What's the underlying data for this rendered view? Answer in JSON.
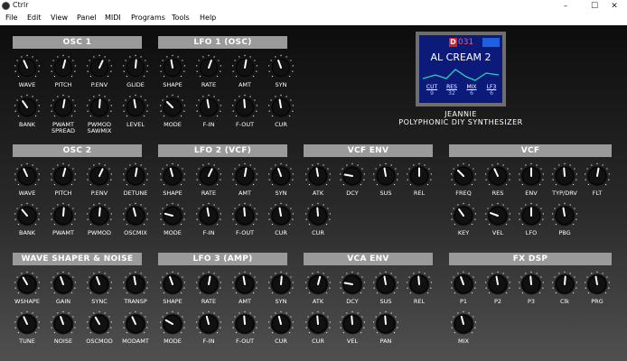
{
  "window": {
    "title": "Ctrlr",
    "controls": {
      "minimize": "–",
      "maximize": "☐",
      "close": "✕"
    }
  },
  "menu": [
    "File",
    "Edit",
    "View",
    "Panel",
    "MIDI",
    "Programs",
    "Tools",
    "Help"
  ],
  "sections": [
    {
      "title": "OSC 1",
      "knobs": [
        "WAVE",
        "PITCH",
        "P.ENV",
        "GLIDE",
        "BANK",
        "PWAMT SPREAD",
        "PWMOD SAWMIX",
        "LEVEL"
      ]
    },
    {
      "title": "LFO 1 (OSC)",
      "knobs": [
        "SHAPE",
        "RATE",
        "AMT",
        "SYN",
        "MODE",
        "F-IN",
        "F-OUT",
        "CUR"
      ]
    },
    {
      "title": "OSC 2",
      "knobs": [
        "WAVE",
        "PITCH",
        "P.ENV",
        "DETUNE",
        "BANK",
        "PWAMT",
        "PWMOD",
        "OSCMIX"
      ]
    },
    {
      "title": "LFO 2 (VCF)",
      "knobs": [
        "SHAPE",
        "RATE",
        "AMT",
        "SYN",
        "MODE",
        "F-IN",
        "F-OUT",
        "CUR"
      ]
    },
    {
      "title": "VCF ENV",
      "knobs": [
        "ATK",
        "DCY",
        "SUS",
        "REL",
        "CUR"
      ]
    },
    {
      "title": "VCF",
      "knobs": [
        "FREQ",
        "RES",
        "ENV",
        "TYP/DRV",
        "FLT",
        "KEY",
        "VEL",
        "LFO",
        "PBG"
      ]
    },
    {
      "title": "WAVE SHAPER & NOISE",
      "knobs": [
        "WSHAPE",
        "GAIN",
        "SYNC",
        "TRANSP",
        "TUNE",
        "NOISE",
        "OSCMOD",
        "MODAMT"
      ]
    },
    {
      "title": "LFO 3 (AMP)",
      "knobs": [
        "SHAPE",
        "RATE",
        "AMT",
        "SYN",
        "MODE",
        "F-IN",
        "F-OUT",
        "CUR"
      ]
    },
    {
      "title": "VCA ENV",
      "knobs": [
        "ATK",
        "DCY",
        "SUS",
        "REL",
        "CUR",
        "VEL",
        "PAN"
      ]
    },
    {
      "title": "FX DSP",
      "knobs": [
        "P1",
        "P2",
        "P3",
        "Clk",
        "PRG",
        "MIX"
      ]
    }
  ],
  "display": {
    "preset_letter": "D",
    "preset_number": "031",
    "patch_name": "AL CREAM 2",
    "params": [
      {
        "name": "CUT",
        "value": "9"
      },
      {
        "name": "RES",
        "value": "32"
      },
      {
        "name": "MIX",
        "value": "6"
      },
      {
        "name": "LF3",
        "value": "6"
      }
    ]
  },
  "synth": {
    "name": "JEANNIE",
    "subtitle": "POLYPHONIC DIY SYNTHESIZER"
  },
  "colors": {
    "panel_top": "#0d0d0d",
    "header_bg": "#9a9a9a",
    "screen_bg": "#0c1a7a",
    "preset_red": "#d42020",
    "wave_cyan": "#2fd0c0"
  }
}
